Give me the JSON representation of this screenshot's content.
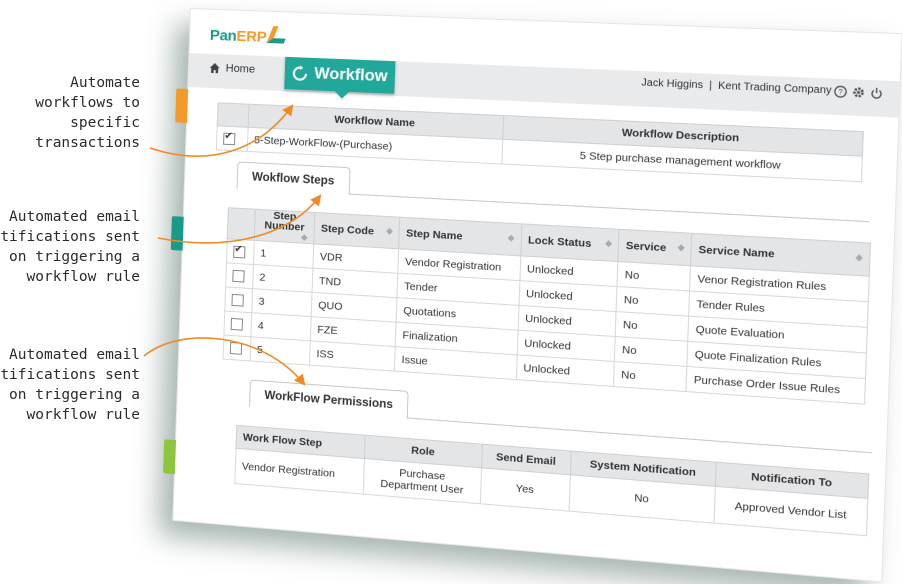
{
  "callouts": [
    {
      "lines": [
        "Automate",
        "workflows to",
        "specific",
        "transactions"
      ]
    },
    {
      "lines": [
        "Automated email",
        "notifications sent",
        "on triggering a",
        "workflow rule"
      ]
    },
    {
      "lines": [
        "Automated email",
        "notifications sent",
        "on triggering a",
        "workflow rule"
      ]
    }
  ],
  "app": {
    "logo": {
      "pan": "Pan",
      "erp": "ERP"
    },
    "home_label": "Home",
    "active_tab": "Workflow",
    "user": "Jack Higgins",
    "company": "Kent Trading Company",
    "separator": "|"
  },
  "workflow_table": {
    "headers": [
      "Workflow Name",
      "Workflow Description"
    ],
    "row": {
      "name": "5-Step-WorkFlow-(Purchase)",
      "description": "5 Step purchase management workflow"
    }
  },
  "steps_section": {
    "tab_label": "Wokflow Steps",
    "headers": [
      "Step Number",
      "Step Code",
      "Step Name",
      "Lock Status",
      "Service",
      "Service Name"
    ],
    "rows": [
      {
        "checked": true,
        "number": "1",
        "code": "VDR",
        "name": "Vendor Registration",
        "lock": "Unlocked",
        "service": "No",
        "service_name": "Venor Registration Rules"
      },
      {
        "checked": false,
        "number": "2",
        "code": "TND",
        "name": "Tender",
        "lock": "Unlocked",
        "service": "No",
        "service_name": "Tender Rules"
      },
      {
        "checked": false,
        "number": "3",
        "code": "QUO",
        "name": "Quotations",
        "lock": "Unlocked",
        "service": "No",
        "service_name": "Quote Evaluation"
      },
      {
        "checked": false,
        "number": "4",
        "code": "FZE",
        "name": "Finalization",
        "lock": "Unlocked",
        "service": "No",
        "service_name": "Quote Finalization Rules"
      },
      {
        "checked": false,
        "number": "5",
        "code": "ISS",
        "name": "Issue",
        "lock": "Unlocked",
        "service": "No",
        "service_name": "Purchase Order Issue Rules"
      }
    ]
  },
  "permissions_section": {
    "tab_label": "WorkFlow Permissions",
    "headers": [
      "Work Flow Step",
      "Role",
      "Send Email",
      "System Notification",
      "Notification To"
    ],
    "row": {
      "step": "Vendor Registration",
      "role_line1": "Purchase",
      "role_line2": "Department User",
      "send_email": "Yes",
      "system_notification": "No",
      "notification_to": "Approved Vendor List"
    }
  },
  "colors": {
    "teal": "#22a89a",
    "orange": "#f39a2b",
    "green": "#8cc63f",
    "arrow": "#f08a24"
  }
}
